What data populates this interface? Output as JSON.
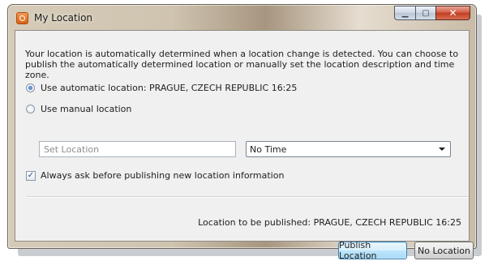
{
  "window": {
    "title": "My Location",
    "app_icon": "location-app-icon",
    "caption_buttons": {
      "minimize": "minimize-icon",
      "maximize": "maximize-icon",
      "close": "close-icon",
      "minimize_glyph": "▁",
      "maximize_glyph": "▢",
      "close_glyph": "✕"
    }
  },
  "dialog": {
    "description": "Your location is automatically determined when a location change is detected. You can choose to publish the automatically determined location or manually set the location description and time zone.",
    "options": {
      "automatic": {
        "label": "Use automatic location: PRAGUE, CZECH REPUBLIC  16:25",
        "selected": true
      },
      "manual": {
        "label": "Use manual location",
        "selected": false
      }
    },
    "manual_fields": {
      "location_placeholder": "Set Location",
      "location_value": "",
      "time_zone_selected": "No Time"
    },
    "always_ask": {
      "label": "Always ask before publishing new location information",
      "checked": true,
      "check_glyph": "✓"
    },
    "publish_status": "Location to be published: PRAGUE, CZECH REPUBLIC  16:25",
    "buttons": {
      "publish": "Publish Location",
      "no_location": "No Location"
    }
  },
  "colors": {
    "accent": "#3c7fb1",
    "close_button": "#c23d22",
    "client_background": "#f0f0f0"
  }
}
